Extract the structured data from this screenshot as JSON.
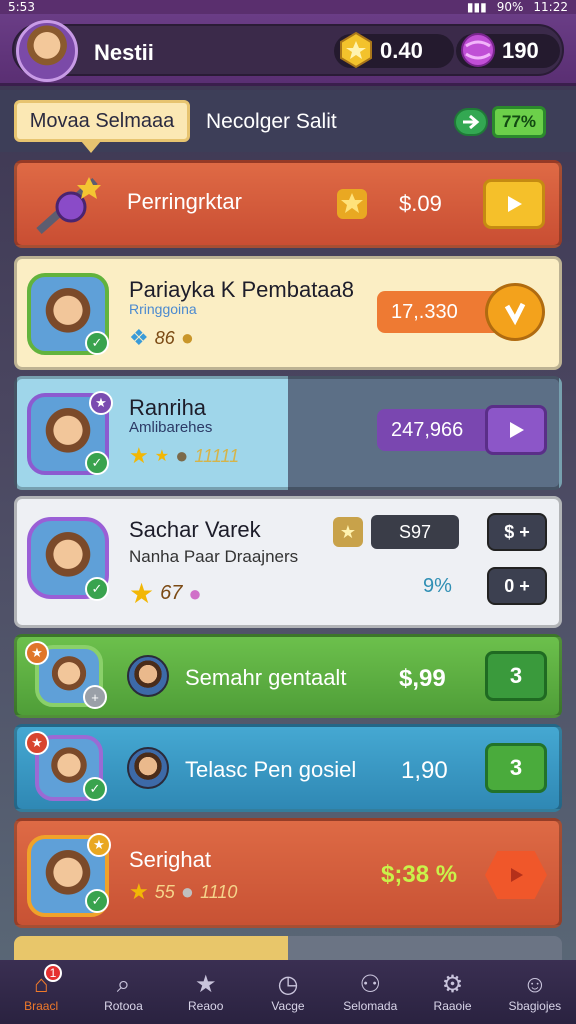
{
  "status": {
    "time": "5:53",
    "battery": "90%",
    "clock": "11:22"
  },
  "header": {
    "title": "Nestii",
    "gold": "0.40",
    "gems": "190"
  },
  "tabs": {
    "active": "Movaa Selmaaa",
    "other": "Necolger Salit",
    "percent": "77%"
  },
  "rows": [
    {
      "title": "Perringrktar",
      "price": "$.09"
    },
    {
      "title": "Pariayka K Pembataa8",
      "sub": "Rringgoina",
      "stars": "86",
      "price": "17,.330"
    },
    {
      "title": "Ranriha",
      "sub": "Amlibarehes",
      "stars": "11111",
      "price": "247,966"
    },
    {
      "title": "Sachar Varek",
      "sub": "Nanha Paar Draajners",
      "stars": "67",
      "price_a": "S97",
      "price_b": "9%",
      "btn_a": "$ +",
      "btn_b": "0 +"
    },
    {
      "title": "Semahr gentaalt",
      "price": "$,99",
      "btn": "3"
    },
    {
      "title": "Telasc Pen gosiel",
      "price": "1,90",
      "btn": "3"
    },
    {
      "title": "Serighat",
      "stars": "55",
      "stars2": "1110",
      "price": "$;38 %"
    }
  ],
  "nav": [
    {
      "label": "Braacl",
      "icon": "home-icon",
      "badge": "1"
    },
    {
      "label": "Rotooa",
      "icon": "search-icon"
    },
    {
      "label": "Reaoo",
      "icon": "star-icon"
    },
    {
      "label": "Vacge",
      "icon": "clock-icon"
    },
    {
      "label": "Selomada",
      "icon": "person-icon"
    },
    {
      "label": "Raaoie",
      "icon": "gear-icon"
    },
    {
      "label": "Sbagiojes",
      "icon": "profile-icon"
    }
  ],
  "colors": {
    "header": "#6a3d86",
    "orange_row": "#d5573b",
    "green_row": "#5fae45",
    "blue_row": "#3b9bc7",
    "cream_row": "#fbeec4"
  }
}
